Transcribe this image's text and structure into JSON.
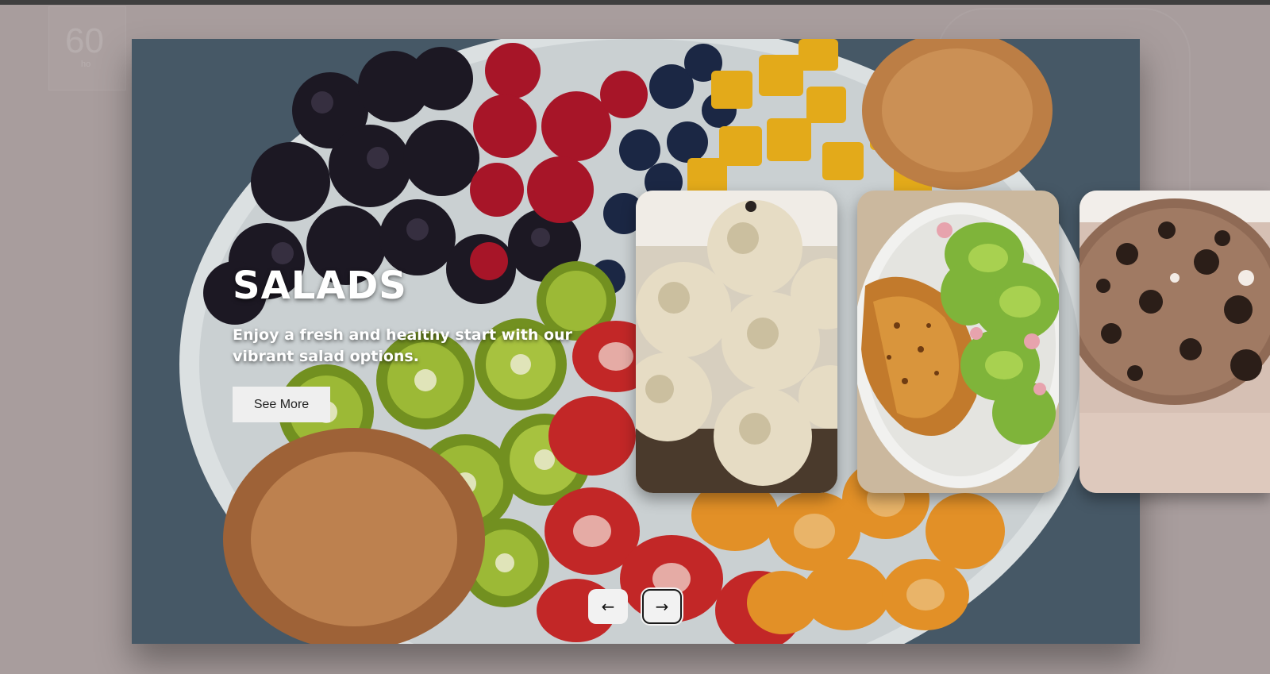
{
  "background": {
    "page_color": "#a89d9d",
    "topbar_color": "#3f3f3f"
  },
  "ghost_badge": {
    "number": "60",
    "sub": "ho"
  },
  "hero": {
    "title": "SALADS",
    "description": "Enjoy a fresh and healthy start with our vibrant salad options.",
    "cta_label": "See More",
    "image": "fruit-salad-bowl-photo"
  },
  "thumbnails": [
    {
      "image": "ladoo-sweets-photo"
    },
    {
      "image": "grilled-chicken-salad-photo"
    },
    {
      "image": "oreo-milkshake-photo"
    }
  ],
  "navigation": {
    "prev_icon": "arrow-left-icon",
    "prev_glyph": "←",
    "next_icon": "arrow-right-icon",
    "next_glyph": "→"
  }
}
